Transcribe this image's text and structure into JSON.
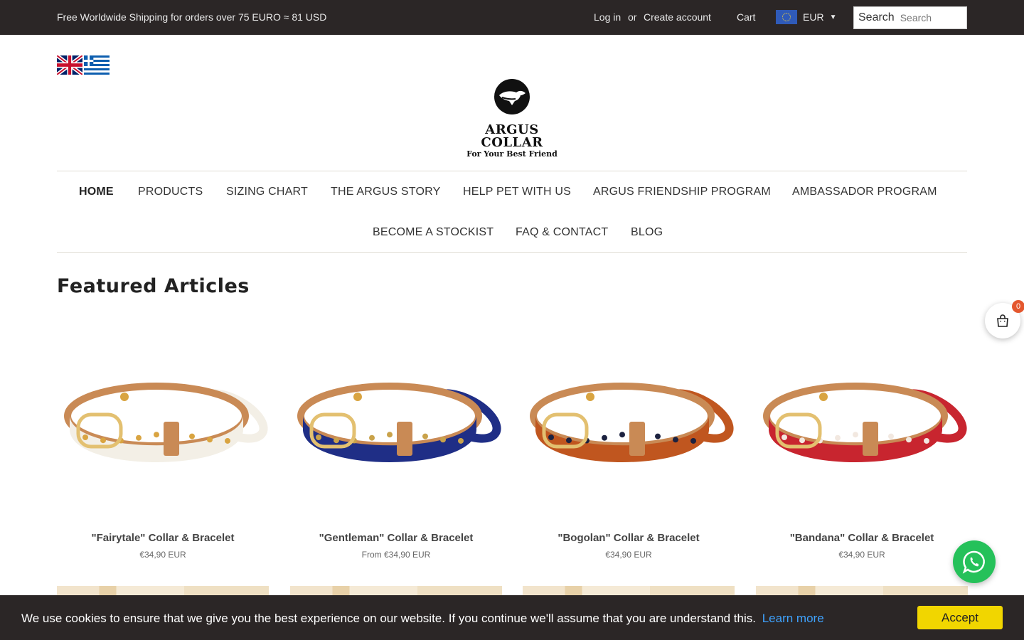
{
  "topbar": {
    "shipping": "Free Worldwide Shipping for orders over 75 EURO ≈ 81 USD",
    "login": "Log in",
    "or": "or",
    "create_account": "Create account",
    "cart": "Cart",
    "currency": "EUR",
    "search_label": "Search",
    "search_placeholder": "Search"
  },
  "languages": [
    "English",
    "Greek"
  ],
  "logo": {
    "name": "ARGUS COLLAR",
    "tagline": "For Your Best Friend"
  },
  "nav": {
    "row1": [
      "HOME",
      "PRODUCTS",
      "SIZING CHART",
      "THE ARGUS STORY",
      "HELP PET WITH US",
      "ARGUS FRIENDSHIP PROGRAM",
      "AMBASSADOR PROGRAM"
    ],
    "row2": [
      "BECOME A STOCKIST",
      "FAQ & CONTACT",
      "BLOG"
    ],
    "active": "HOME"
  },
  "featured": {
    "title": "Featured Articles",
    "products": [
      {
        "title": "\"Fairytale\" Collar & Bracelet",
        "price": "€34,90 EUR",
        "color": "#f3efe6",
        "pattern": "#d9a441"
      },
      {
        "title": "\"Gentleman\" Collar & Bracelet",
        "price": "From €34,90 EUR",
        "color": "#1f2e86",
        "pattern": "#c9a24a"
      },
      {
        "title": "\"Bogolan\" Collar & Bracelet",
        "price": "€34,90 EUR",
        "color": "#c0561f",
        "pattern": "#1c2240"
      },
      {
        "title": "\"Bandana\" Collar & Bracelet",
        "price": "€34,90 EUR",
        "color": "#c8252f",
        "pattern": "#f2e8e0"
      }
    ]
  },
  "floating_cart": {
    "count": "0"
  },
  "cookie": {
    "message": "We use cookies to ensure that we give you the best experience on our website. If you continue we'll assume that you are understand this.",
    "learn_more": "Learn more",
    "accept": "Accept"
  }
}
